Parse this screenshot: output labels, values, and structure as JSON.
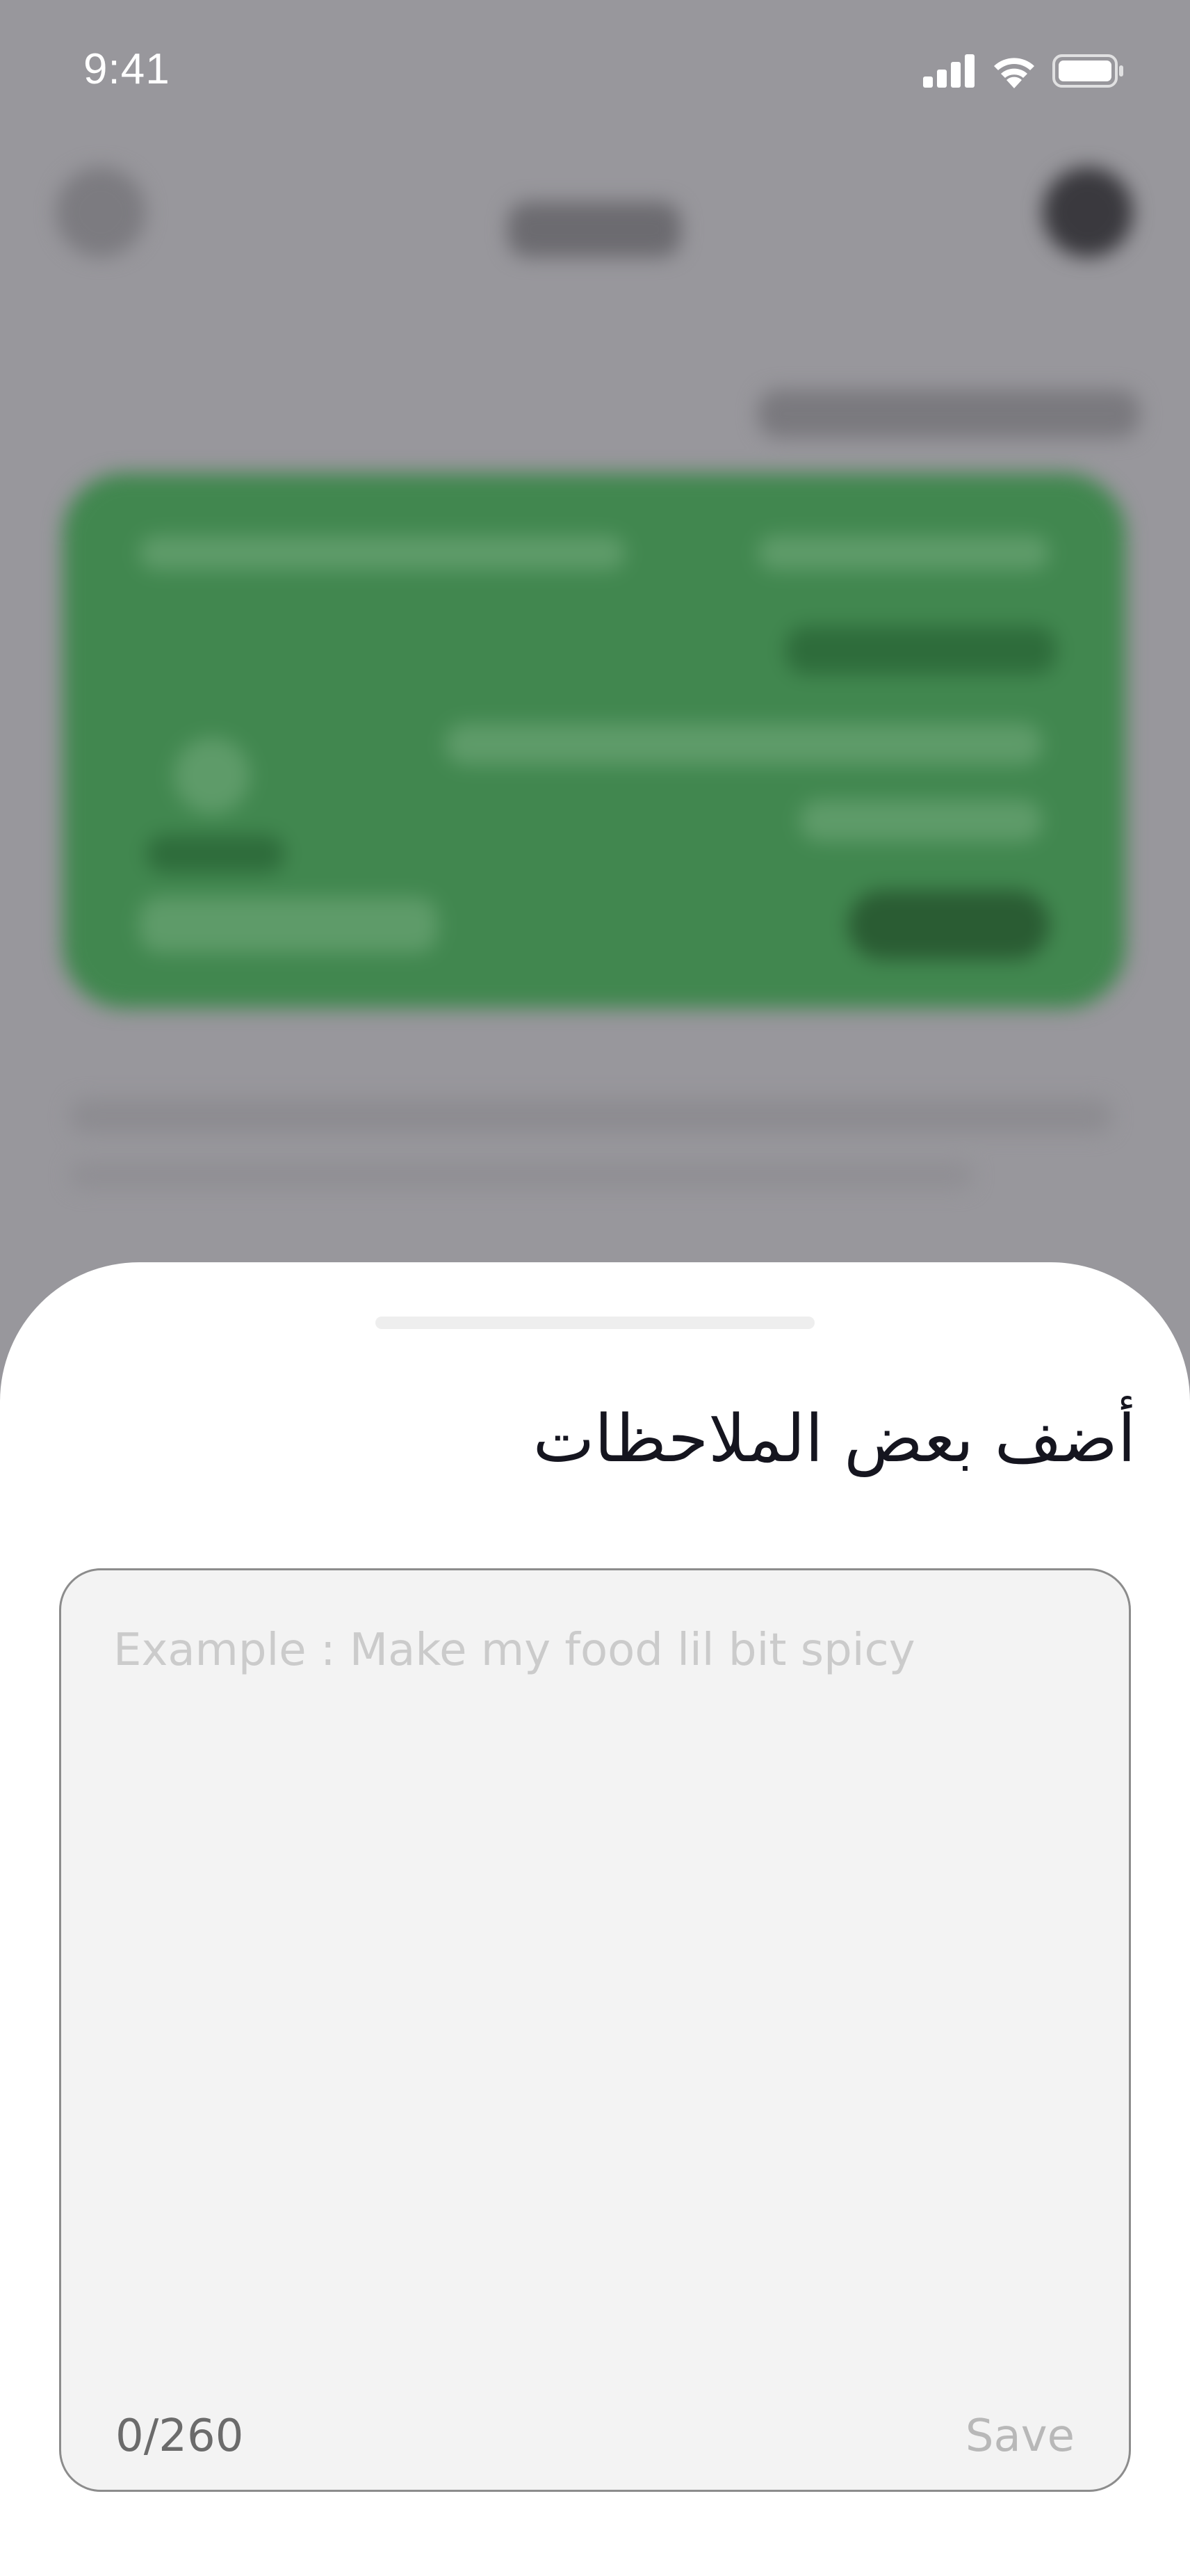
{
  "status_bar": {
    "time": "9:41",
    "icons": [
      "cellular-signal-icon",
      "wifi-icon",
      "battery-icon"
    ]
  },
  "notes_sheet": {
    "title": "أضف بعض الملاحظات",
    "input_value": "",
    "input_placeholder": "Example : Make my food lil bit spicy",
    "char_count": "0/260",
    "save_label": "Save"
  },
  "colors": {
    "overlay": "#98979c",
    "card_green": "#41874f",
    "sheet_background": "#ffffff",
    "input_background": "#f3f3f3",
    "title_text": "#15151f",
    "placeholder_text": "#cbcbcb",
    "disabled_text": "#b8b8b8"
  }
}
